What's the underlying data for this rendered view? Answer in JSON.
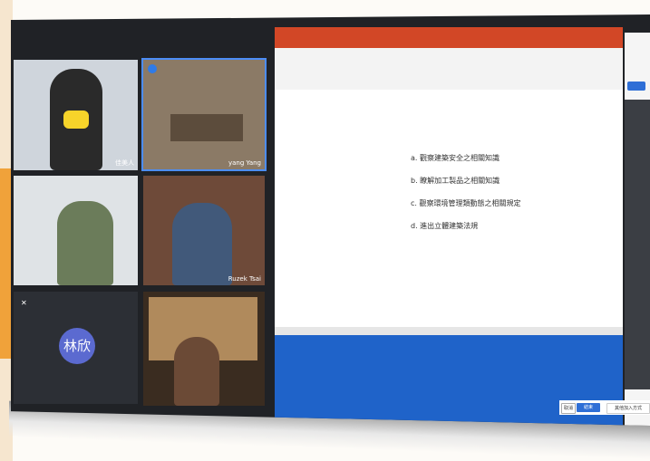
{
  "participants": [
    {
      "name": "佳美人",
      "mask_color": "#f7d42a"
    },
    {
      "name": "yang Yang"
    },
    {
      "name": ""
    },
    {
      "name": "Ruzek Tsai"
    },
    {
      "name": "林欣",
      "avatar_text": "林欣",
      "avatar_color": "#5b6ad0"
    },
    {
      "name": ""
    }
  ],
  "slide": {
    "lines": [
      "a. 觀察建築安全之相關知識",
      "b. 瞭解加工製品之相關知識",
      "c. 觀察環境管理類動態之相關規定",
      "d. 進出立體建築法規"
    ]
  },
  "panel": {
    "button_label": "檢視"
  },
  "footer": {
    "left_btn": "取消",
    "right_btn": "結束",
    "text": "其他加入方式"
  },
  "colors": {
    "accent": "#4c8df6",
    "ppt_red": "#d24726",
    "taskbar_blue": "#1f63c9"
  }
}
